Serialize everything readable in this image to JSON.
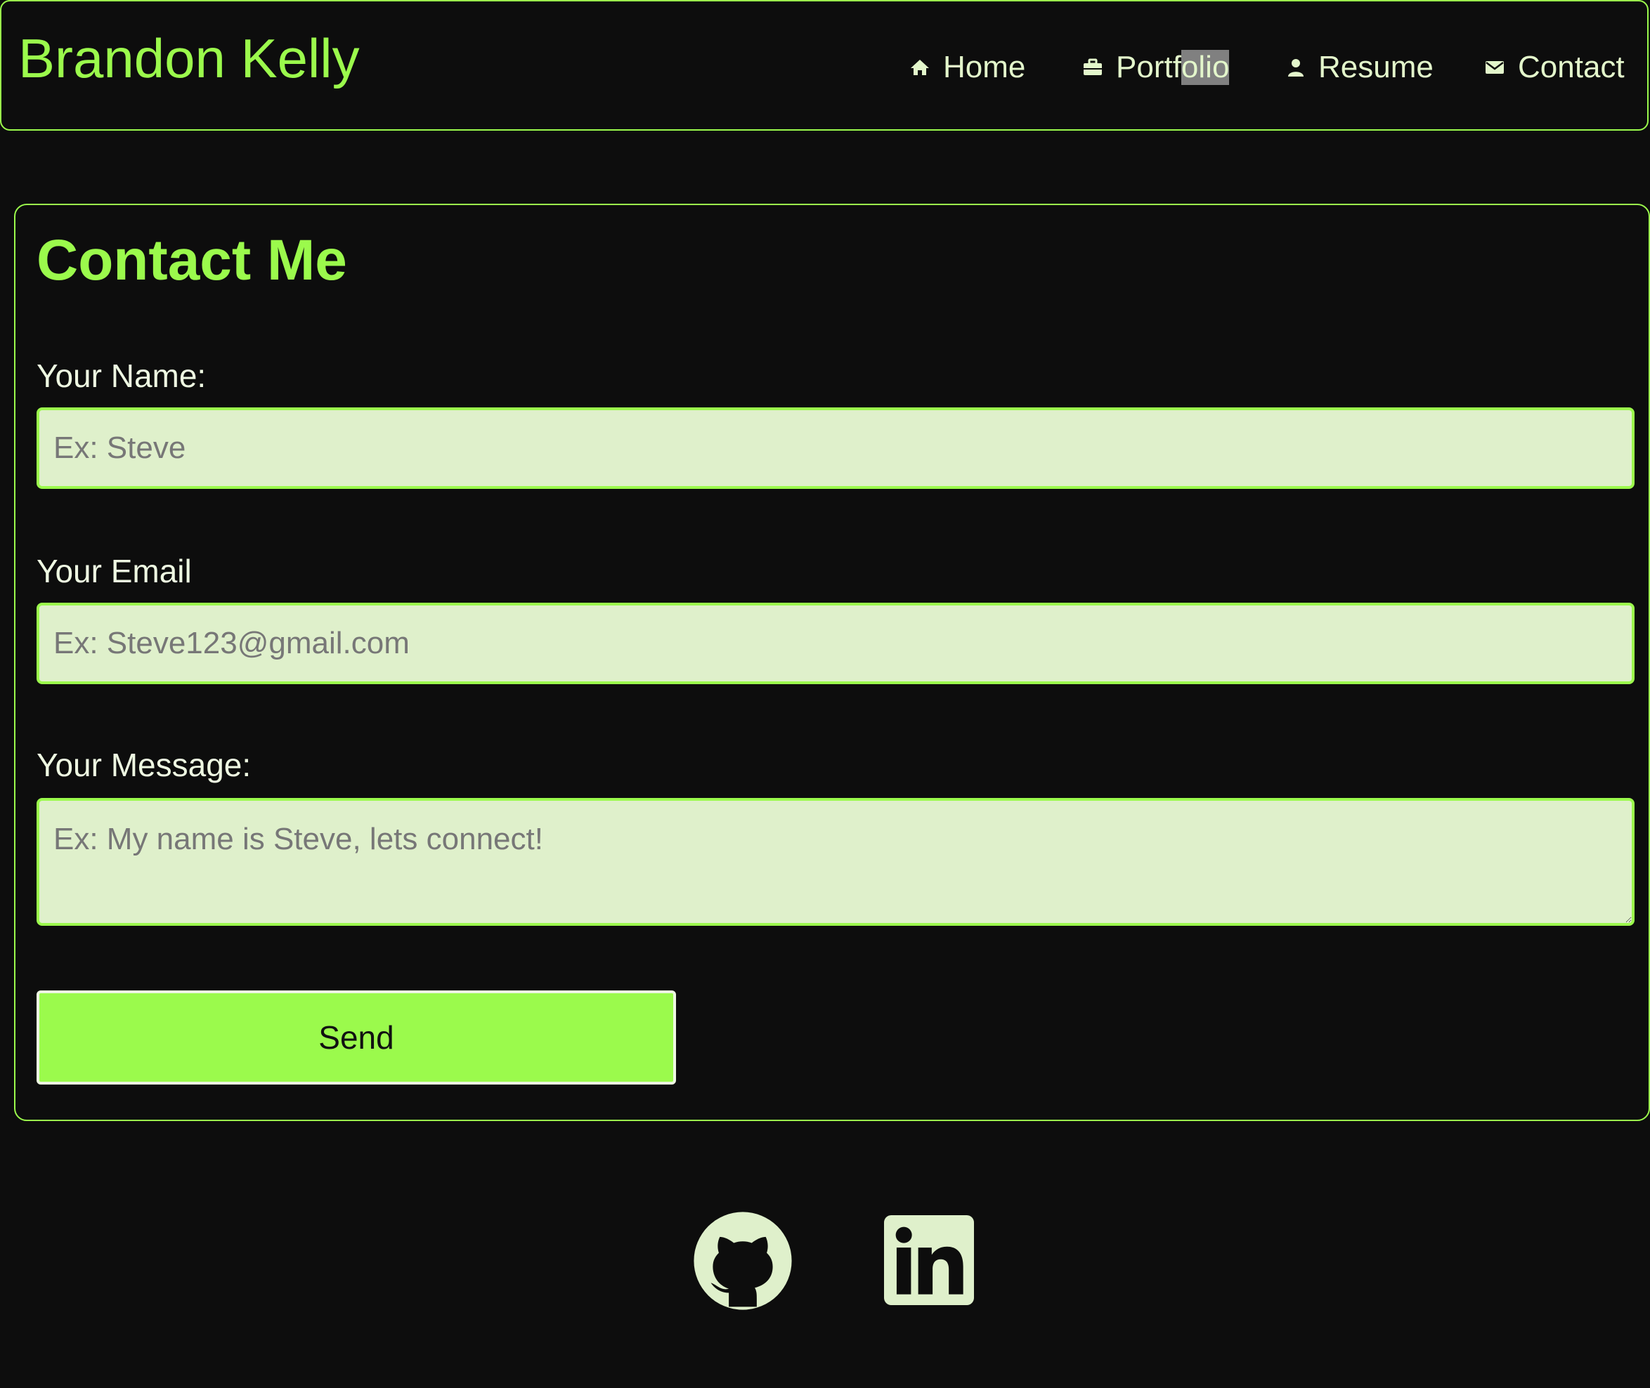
{
  "header": {
    "brand": "Brandon Kelly",
    "nav": {
      "home": "Home",
      "portfolio_prefix": "Portf",
      "portfolio_selected": "olio",
      "resume": "Resume",
      "contact": "Contact"
    }
  },
  "contact": {
    "title": "Contact Me",
    "name_label": "Your Name:",
    "name_placeholder": "Ex: Steve",
    "email_label": "Your Email",
    "email_placeholder": "Ex: Steve123@gmail.com",
    "message_label": "Your Message:",
    "message_placeholder": "Ex: My name is Steve, lets connect!",
    "send_label": "Send"
  },
  "footer": {
    "icons": [
      "github-icon",
      "linkedin-icon"
    ]
  },
  "colors": {
    "background": "#0d0d0d",
    "accent": "#9bfa4c",
    "field_bg": "#dff0cb",
    "nav_text": "#e3f6cb"
  }
}
